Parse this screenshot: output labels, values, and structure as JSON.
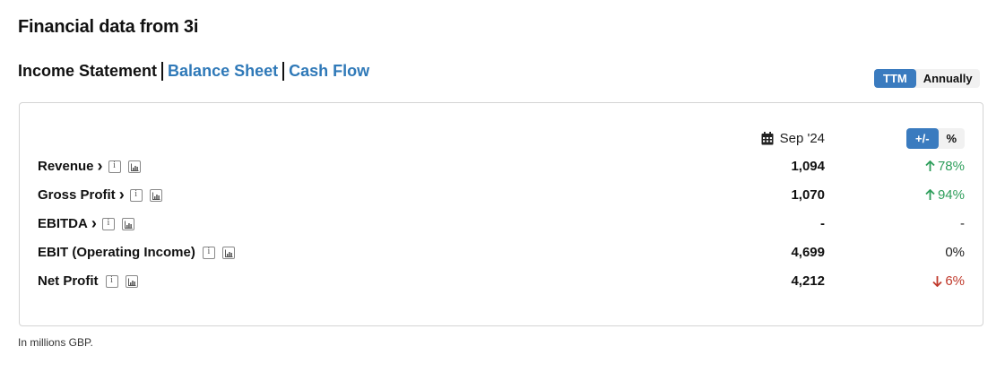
{
  "page": {
    "title": "Financial data from 3i"
  },
  "statements": {
    "active": "Income Statement",
    "balance_sheet": "Balance Sheet",
    "cash_flow": "Cash Flow"
  },
  "period_toggle": {
    "ttm": "TTM",
    "annually": "Annually",
    "selected": "TTM"
  },
  "table": {
    "column_date": "Sep '24",
    "mode_toggle": {
      "abs": "+/-",
      "pct": "%",
      "selected": "+/-"
    },
    "rows": [
      {
        "label": "Revenue",
        "expandable": true,
        "value": "1,094",
        "change": "78%",
        "direction": "up"
      },
      {
        "label": "Gross Profit",
        "expandable": true,
        "value": "1,070",
        "change": "94%",
        "direction": "up"
      },
      {
        "label": "EBITDA",
        "expandable": true,
        "value": "-",
        "change": "-",
        "direction": "neutral"
      },
      {
        "label": "EBIT (Operating Income)",
        "expandable": false,
        "value": "4,699",
        "change": "0%",
        "direction": "neutral"
      },
      {
        "label": "Net Profit",
        "expandable": false,
        "value": "4,212",
        "change": "6%",
        "direction": "down"
      }
    ]
  },
  "footnote": "In millions GBP.",
  "colors": {
    "accent": "#3a7bbf",
    "link": "#2f79b8",
    "up": "#2e9e5b",
    "down": "#c0392b"
  }
}
